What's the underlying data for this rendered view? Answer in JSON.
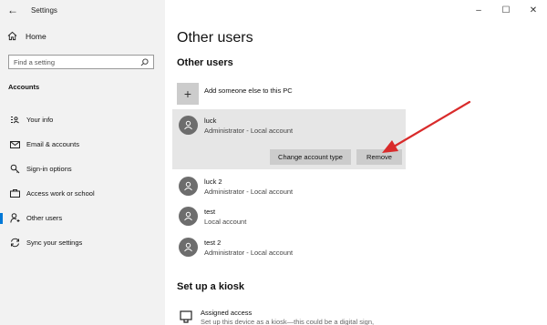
{
  "window": {
    "app_title": "Settings",
    "minimize": "–",
    "maximize": "☐",
    "close": "✕"
  },
  "sidebar": {
    "home_label": "Home",
    "search_placeholder": "Find a setting",
    "section_label": "Accounts",
    "items": [
      {
        "label": "Your info",
        "icon": "id-card-icon",
        "active": false
      },
      {
        "label": "Email & accounts",
        "icon": "mail-icon",
        "active": false
      },
      {
        "label": "Sign-in options",
        "icon": "key-icon",
        "active": false
      },
      {
        "label": "Access work or school",
        "icon": "briefcase-icon",
        "active": false
      },
      {
        "label": "Other users",
        "icon": "person-icon",
        "active": true
      },
      {
        "label": "Sync your settings",
        "icon": "sync-icon",
        "active": false
      }
    ]
  },
  "main": {
    "page_title": "Other users",
    "section_title": "Other users",
    "add_label": "Add someone else to this PC",
    "users": [
      {
        "name": "luck",
        "sub": "Administrator - Local account",
        "selected": true
      },
      {
        "name": "luck 2",
        "sub": "Administrator - Local account",
        "selected": false
      },
      {
        "name": "test",
        "sub": "Local account",
        "selected": false
      },
      {
        "name": "test 2",
        "sub": "Administrator - Local account",
        "selected": false
      }
    ],
    "change_button": "Change account type",
    "remove_button": "Remove",
    "kiosk_title": "Set up a kiosk",
    "kiosk_item_name": "Assigned access",
    "kiosk_item_desc": "Set up this device as a kiosk—this could be a digital sign,"
  },
  "colors": {
    "accent": "#0078d7",
    "annotation_arrow": "#d92b2b",
    "sidebar_bg": "#f2f2f2",
    "button_bg": "#cccccc",
    "avatar_bg": "#6d6d6d"
  }
}
